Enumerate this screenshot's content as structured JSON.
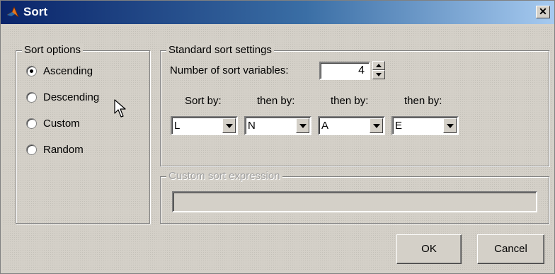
{
  "window": {
    "title": "Sort",
    "close_symbol": "✕"
  },
  "sort_options": {
    "legend": "Sort options",
    "options": [
      {
        "label": "Ascending",
        "selected": true
      },
      {
        "label": "Descending",
        "selected": false
      },
      {
        "label": "Custom",
        "selected": false
      },
      {
        "label": "Random",
        "selected": false
      }
    ]
  },
  "standard": {
    "legend": "Standard sort settings",
    "num_label": "Number of sort variables:",
    "num_value": "4",
    "headers": [
      "Sort by:",
      "then by:",
      "then by:",
      "then by:"
    ],
    "values": [
      "L",
      "N",
      "A",
      "E"
    ]
  },
  "custom_expr": {
    "legend": "Custom sort expression",
    "value": ""
  },
  "buttons": {
    "ok": "OK",
    "cancel": "Cancel"
  }
}
